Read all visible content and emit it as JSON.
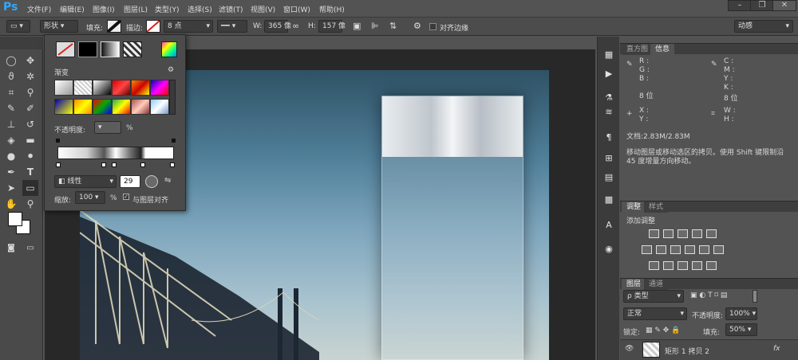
{
  "app": {
    "logo": "Ps"
  },
  "menu": [
    "文件(F)",
    "编辑(E)",
    "图像(I)",
    "图层(L)",
    "类型(Y)",
    "选择(S)",
    "滤镜(T)",
    "视图(V)",
    "窗口(W)",
    "帮助(H)"
  ],
  "window_controls": {
    "minimize": "–",
    "restore": "❐",
    "close": "✕"
  },
  "options": {
    "mode": "形状",
    "fill_label": "填充:",
    "stroke_label": "描边:",
    "stroke_width": "8 点",
    "w_label": "W:",
    "w_value": "365 像",
    "h_label": "H:",
    "h_value": "157 像",
    "align_edges": "对齐边缘",
    "workspace": "动感"
  },
  "popup": {
    "title": "渐变",
    "opacity_label": "不透明度:",
    "opacity_unit": "%",
    "style": "线性",
    "angle": "29",
    "scale_label": "缩放:",
    "scale_value": "100",
    "scale_unit": "%",
    "align_label": "与图层对齐"
  },
  "info_panel": {
    "tabs": [
      "直方图",
      "信息"
    ],
    "rgb": [
      "R :",
      "G :",
      "B :"
    ],
    "cmyk": [
      "C :",
      "M :",
      "Y :",
      "K :"
    ],
    "bits1": "8 位",
    "bits2": "8 位",
    "xy": [
      "X :",
      "Y :"
    ],
    "wh": [
      "W :",
      "H :"
    ],
    "doc": "文档:2.83M/2.83M",
    "hint": "移动图层或移动选区的拷贝。使用 Shift 键限制沿",
    "hint2": "45 度增量方向移动。"
  },
  "adjust_panel": {
    "tabs": [
      "调整",
      "样式"
    ],
    "title": "添加调整"
  },
  "layers_panel": {
    "tabs": [
      "图层",
      "通道"
    ],
    "kind": "ρ 类型",
    "blend": "正常",
    "opacity_label": "不透明度:",
    "opacity": "100%",
    "lock_label": "锁定:",
    "fill_label": "填充:",
    "fill": "50%",
    "layer_name": "矩形 1 拷贝 2",
    "fx": "fx"
  },
  "colors": {
    "accent": "#31a8ff"
  }
}
